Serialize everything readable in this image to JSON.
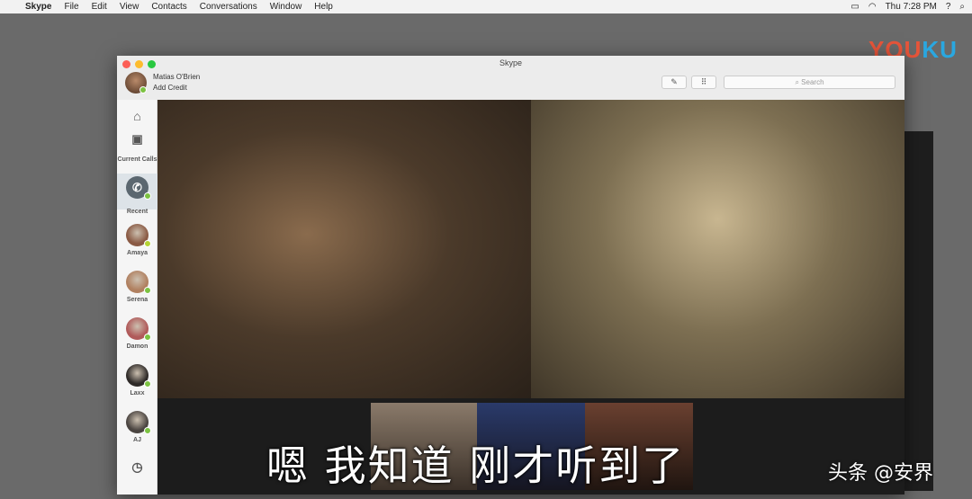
{
  "menubar": {
    "app": "Skype",
    "items": [
      "File",
      "Edit",
      "View",
      "Contacts",
      "Conversations",
      "Window",
      "Help"
    ],
    "clock": "Thu 7:28 PM"
  },
  "logo": {
    "text1": "YOU",
    "text2": "KU"
  },
  "window": {
    "title": "Skype",
    "user": "Matias O'Brien",
    "credit": "Add Credit",
    "search_placeholder": "Search"
  },
  "sidebar": {
    "current_calls": "Current Calls",
    "recent": "Recent",
    "contacts": [
      {
        "name": "Amaya",
        "color": "#8a5a44",
        "status": "#b5d334"
      },
      {
        "name": "Serena",
        "color": "#b08060",
        "status": "#7cc242"
      },
      {
        "name": "Damon",
        "color": "#b05a5a",
        "status": "#7cc242"
      },
      {
        "name": "Laxx",
        "color": "#2e2a28",
        "status": "#7cc242"
      },
      {
        "name": "AJ",
        "color": "#4a4440",
        "status": "#7cc242"
      }
    ]
  },
  "subtitle": "嗯 我知道 刚才听到了",
  "watermark": "头条 @安界"
}
